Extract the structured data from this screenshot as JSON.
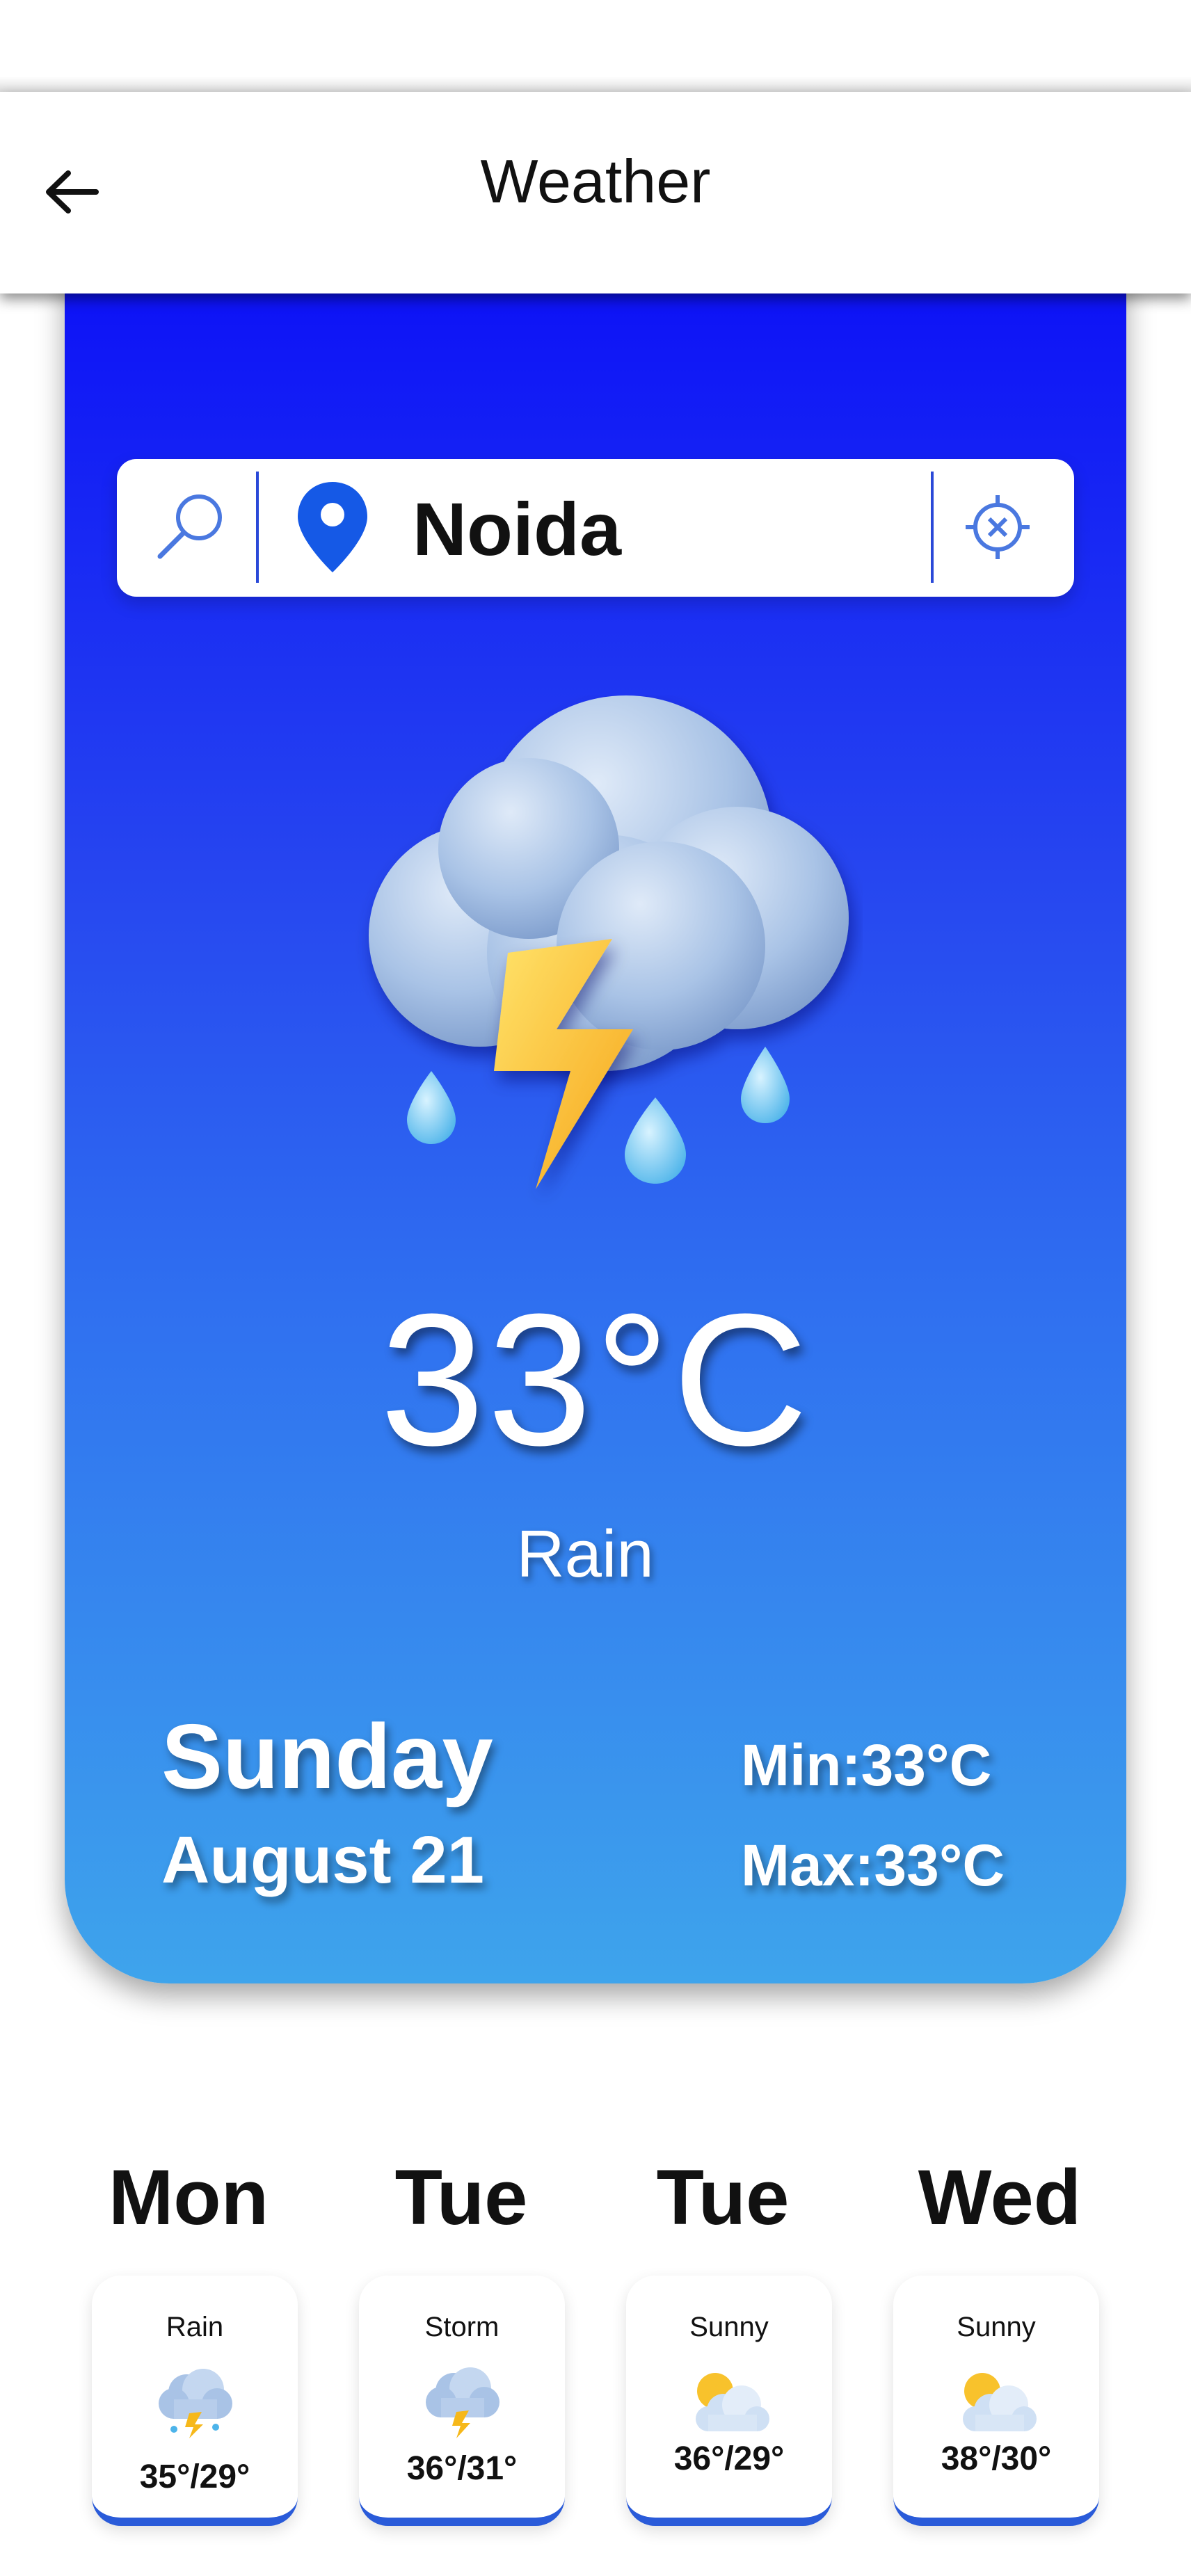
{
  "appbar": {
    "title": "Weather"
  },
  "search": {
    "city": "Noida"
  },
  "current": {
    "temperature": "33°C",
    "condition": "Rain",
    "day": "Sunday",
    "date": "August 21",
    "min": "Min:33°C",
    "max": "Max:33°C"
  },
  "forecast": [
    {
      "day": "Mon",
      "condition": "Rain",
      "temps": "35°/29°",
      "icon": "rain-storm-cloud-icon"
    },
    {
      "day": "Tue",
      "condition": "Storm",
      "temps": "36°/31°",
      "icon": "storm-cloud-icon"
    },
    {
      "day": "Tue",
      "condition": "Sunny",
      "temps": "36°/29°",
      "icon": "sun-behind-cloud-icon"
    },
    {
      "day": "Wed",
      "condition": "Sunny",
      "temps": "38°/30°",
      "icon": "sun-behind-cloud-icon"
    }
  ],
  "colors": {
    "card_top": "#0c10f7",
    "card_bottom": "#3ea4ec",
    "accent": "#2a5bd9"
  }
}
